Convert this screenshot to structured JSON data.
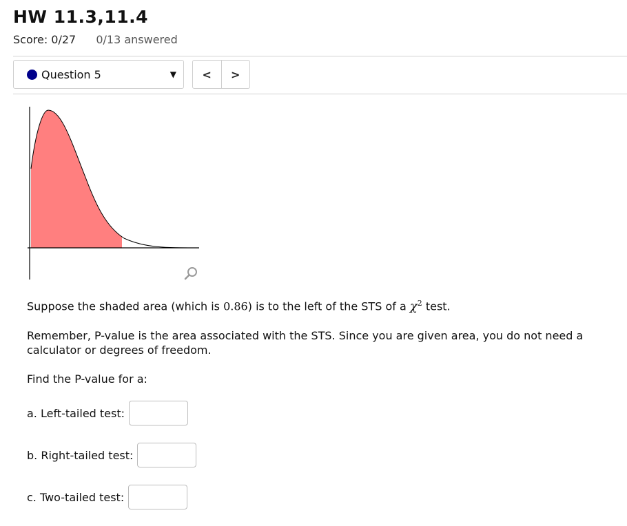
{
  "header": {
    "title": "HW 11.3,11.4",
    "score": "Score: 0/27",
    "answered": "0/13 answered"
  },
  "question_nav": {
    "current_label": "Question 5",
    "prev_label": "<",
    "next_label": ">"
  },
  "graph": {
    "shaded_color": "#ff7f7f",
    "shaded_area": 0.86
  },
  "problem": {
    "intro_pre": "Suppose the shaded area (which is ",
    "area_value": "0.86",
    "intro_mid": ") is to the left of the STS of a ",
    "chi_symbol": "χ",
    "chi_power": "2",
    "intro_post": " test.",
    "remember": "Remember, P-value is the area associated with the STS. Since you are given area, you do not need a calculator or degrees of freedom.",
    "find": "Find the P-value for a:",
    "answers": [
      {
        "label": "a. Left-tailed test:",
        "value": ""
      },
      {
        "label": "b. Right-tailed test:",
        "value": ""
      },
      {
        "label": "c. Two-tailed test:",
        "value": ""
      }
    ]
  },
  "colors": {
    "question_dot": "#00008b"
  }
}
